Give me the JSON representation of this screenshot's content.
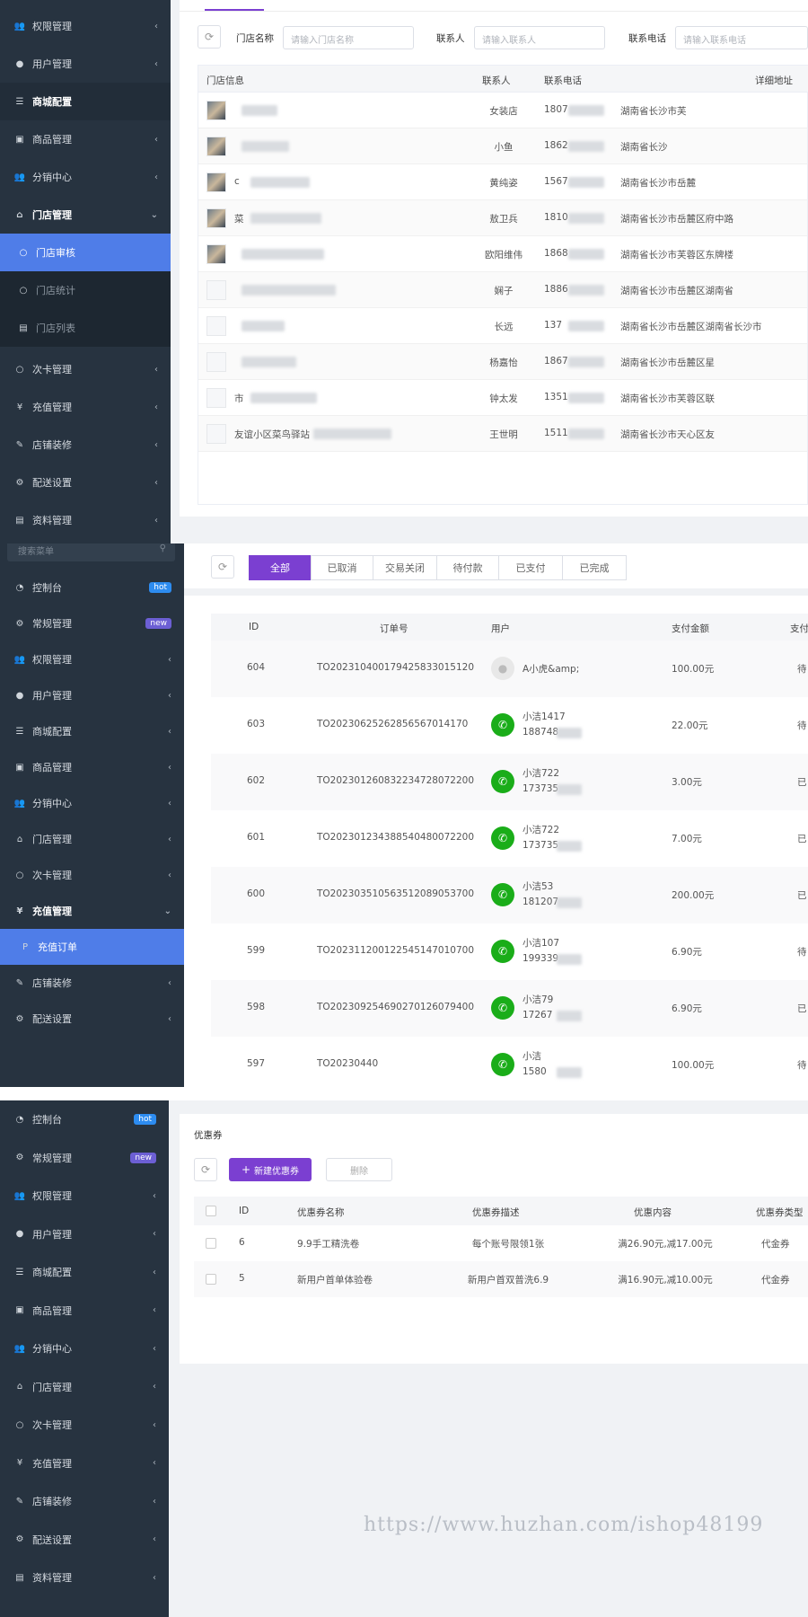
{
  "colors": {
    "sidebar_bg": "#273340",
    "active_blue": "#4f7de8",
    "primary_purple": "#7b3fd1",
    "hot_badge": "#2d8cf0",
    "new_badge": "#6c5fd4",
    "wechat_green": "#1aad19"
  },
  "panel1": {
    "sidebar": [
      {
        "label": "权限管理",
        "icon": "users-icon"
      },
      {
        "label": "用户管理",
        "icon": "user-icon"
      },
      {
        "label": "商城配置",
        "icon": "sliders-icon"
      },
      {
        "label": "商品管理",
        "icon": "box-icon"
      },
      {
        "label": "分销中心",
        "icon": "users-icon"
      },
      {
        "label": "门店管理",
        "icon": "bank-icon"
      },
      {
        "label": "门店审核",
        "icon": "circle-icon"
      },
      {
        "label": "门店统计",
        "icon": "circle-icon"
      },
      {
        "label": "门店列表",
        "icon": "doc-icon"
      },
      {
        "label": "次卡管理",
        "icon": "circle-icon"
      },
      {
        "label": "充值管理",
        "icon": "yen-icon"
      },
      {
        "label": "店铺装修",
        "icon": "brush-icon"
      },
      {
        "label": "配送设置",
        "icon": "gears-icon"
      },
      {
        "label": "资料管理",
        "icon": "doc-icon"
      }
    ],
    "filters": {
      "store_name_label": "门店名称",
      "store_name_placeholder": "请输入门店名称",
      "contact_label": "联系人",
      "contact_placeholder": "请输入联系人",
      "phone_label": "联系电话",
      "phone_placeholder": "请输入联系电话"
    },
    "columns": [
      "门店信息",
      "联系人",
      "联系电话",
      "详细地址"
    ],
    "rows": [
      {
        "name": "",
        "contact": "女装店",
        "phone": "1807",
        "address": "湖南省长沙市芙"
      },
      {
        "name": "",
        "contact": "小鱼",
        "phone": "1862",
        "address": "湖南省长沙"
      },
      {
        "name": "c",
        "contact": "黄纯姿",
        "phone": "1567",
        "address": "湖南省长沙市岳麓"
      },
      {
        "name": "菜",
        "contact": "敖卫兵",
        "phone": "1810",
        "address": "湖南省长沙市岳麓区府中路"
      },
      {
        "name": "",
        "contact": "欧阳维伟",
        "phone": "1868",
        "address": "湖南省长沙市芙蓉区东牌楼"
      },
      {
        "name": "",
        "contact": "娴子",
        "phone": "1886",
        "address": "湖南省长沙市岳麓区湖南省"
      },
      {
        "name": "",
        "contact": "长远",
        "phone": "137",
        "address": "湖南省长沙市岳麓区湖南省长沙市"
      },
      {
        "name": "",
        "contact": "杨嘉怡",
        "phone": "1867",
        "address": "湖南省长沙市岳麓区星"
      },
      {
        "name": "市",
        "contact": "钟太发",
        "phone": "1351",
        "address": "湖南省长沙市芙蓉区联"
      },
      {
        "name": "友谊小区菜鸟驿站",
        "contact": "王世明",
        "phone": "1511",
        "address": "湖南省长沙市天心区友"
      }
    ]
  },
  "panel2": {
    "sidebar": [
      {
        "label": "控制台",
        "icon": "dashboard-icon",
        "badge": "hot"
      },
      {
        "label": "常规管理",
        "icon": "gears-icon",
        "badge": "new"
      },
      {
        "label": "权限管理",
        "icon": "users-icon"
      },
      {
        "label": "用户管理",
        "icon": "user-icon"
      },
      {
        "label": "商城配置",
        "icon": "sliders-icon"
      },
      {
        "label": "商品管理",
        "icon": "box-icon"
      },
      {
        "label": "分销中心",
        "icon": "users-icon"
      },
      {
        "label": "门店管理",
        "icon": "bank-icon"
      },
      {
        "label": "次卡管理",
        "icon": "circle-icon"
      },
      {
        "label": "充值管理",
        "icon": "yen-icon"
      },
      {
        "label": "充值订单",
        "icon": "paypal-icon"
      },
      {
        "label": "店铺装修",
        "icon": "brush-icon"
      },
      {
        "label": "配送设置",
        "icon": "gears-icon"
      }
    ],
    "search_placeholder": "搜索菜单",
    "tabs": [
      "全部",
      "已取消",
      "交易关闭",
      "待付款",
      "已支付",
      "已完成"
    ],
    "columns": [
      "ID",
      "订单号",
      "用户",
      "支付金额",
      "支付"
    ],
    "rows": [
      {
        "id": "604",
        "order": "TO20231040017942583301512​0",
        "user": "A小虎&amp;",
        "phone": "",
        "amount": "100.00元",
        "status": "待",
        "avatar": "default"
      },
      {
        "id": "603",
        "order": "TO20230625262856567014170",
        "user": "小洁1417",
        "phone": "188748",
        "amount": "22.00元",
        "status": "待",
        "avatar": "wechat"
      },
      {
        "id": "602",
        "order": "TO20230126083223472807220​0",
        "user": "小洁722",
        "phone": "173735",
        "amount": "3.00元",
        "status": "已",
        "avatar": "wechat"
      },
      {
        "id": "601",
        "order": "TO20230123438854048007220​0",
        "user": "小洁722",
        "phone": "173735",
        "amount": "7.00元",
        "status": "已",
        "avatar": "wechat"
      },
      {
        "id": "600",
        "order": "TO20230351056351208905370​0",
        "user": "小洁53",
        "phone": "181207",
        "amount": "200.00元",
        "status": "已",
        "avatar": "wechat"
      },
      {
        "id": "599",
        "order": "TO20231120012254514701070​0",
        "user": "小洁107",
        "phone": "199339",
        "amount": "6.90元",
        "status": "待",
        "avatar": "wechat"
      },
      {
        "id": "598",
        "order": "TO20230925469027012607940​0",
        "user": "小洁79",
        "phone": "17267",
        "amount": "6.90元",
        "status": "已",
        "avatar": "wechat"
      },
      {
        "id": "597",
        "order": "TO20230440",
        "user": "小洁",
        "phone": "1580",
        "amount": "100.00元",
        "status": "待",
        "avatar": "wechat"
      }
    ]
  },
  "panel3": {
    "sidebar": [
      {
        "label": "控制台",
        "icon": "dashboard-icon",
        "badge": "hot"
      },
      {
        "label": "常规管理",
        "icon": "gears-icon",
        "badge": "new"
      },
      {
        "label": "权限管理",
        "icon": "users-icon"
      },
      {
        "label": "用户管理",
        "icon": "user-icon"
      },
      {
        "label": "商城配置",
        "icon": "sliders-icon"
      },
      {
        "label": "商品管理",
        "icon": "box-icon"
      },
      {
        "label": "分销中心",
        "icon": "users-icon"
      },
      {
        "label": "门店管理",
        "icon": "bank-icon"
      },
      {
        "label": "次卡管理",
        "icon": "circle-icon"
      },
      {
        "label": "充值管理",
        "icon": "yen-icon"
      },
      {
        "label": "店铺装修",
        "icon": "brush-icon"
      },
      {
        "label": "配送设置",
        "icon": "gears-icon"
      },
      {
        "label": "资料管理",
        "icon": "doc-icon"
      }
    ],
    "title": "优惠券",
    "new_button": "新建优惠券",
    "delete_button": "删除",
    "columns": [
      "ID",
      "优惠券名称",
      "优惠券描述",
      "优惠内容",
      "优惠券类型"
    ],
    "rows": [
      {
        "id": "6",
        "name": "9.9手工精洗卷",
        "desc": "每个账号限领1张",
        "content": "满26.90元,减17.00元",
        "type": "代金券"
      },
      {
        "id": "5",
        "name": "新用户首单体验卷",
        "desc": "新用户首双普洗6.9",
        "content": "满16.90元,减10.00元",
        "type": "代金券"
      }
    ]
  },
  "watermark": "https://www.huzhan.com/ishop48199"
}
